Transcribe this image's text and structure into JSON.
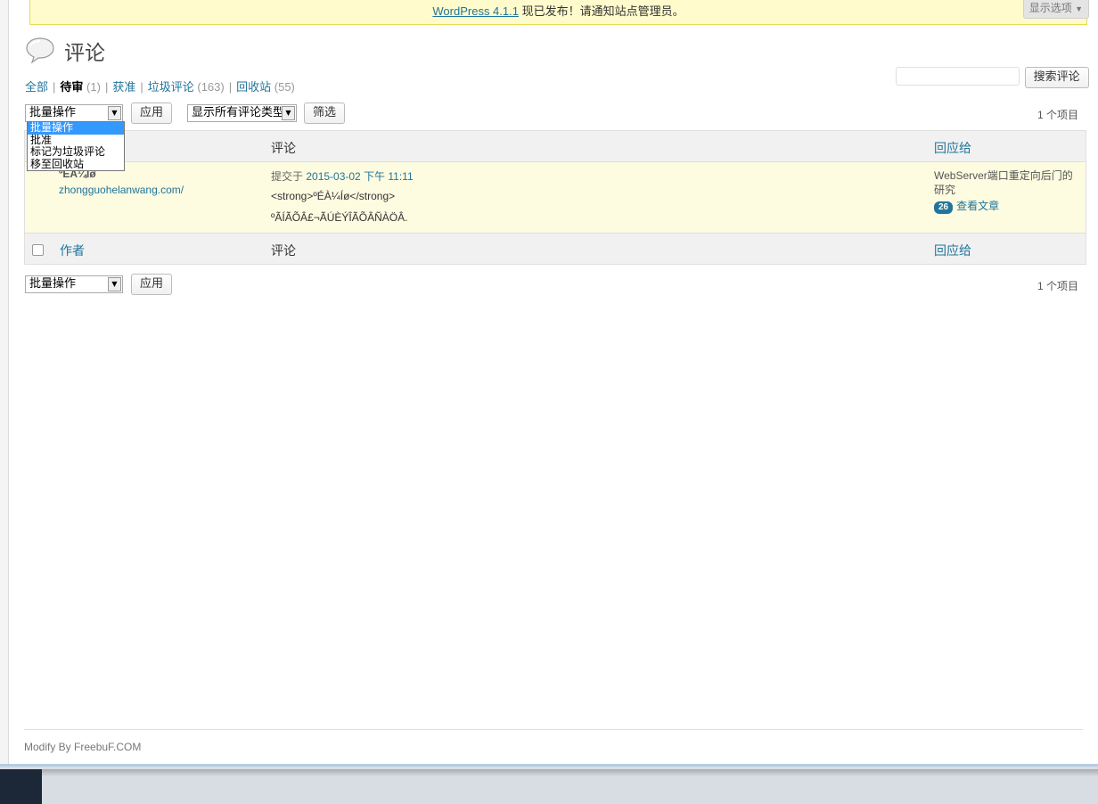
{
  "notice": {
    "link": "WordPress 4.1.1",
    "text": " 现已发布！请通知站点管理员。"
  },
  "screen_options": "显示选项",
  "page": {
    "title": "评论"
  },
  "filters": [
    {
      "label": "全部",
      "count": ""
    },
    {
      "label": "待审",
      "count": "(1)"
    },
    {
      "label": "获准",
      "count": ""
    },
    {
      "label": "垃圾评论",
      "count": "(163)"
    },
    {
      "label": "回收站",
      "count": "(55)"
    }
  ],
  "search": {
    "button": "搜索评论",
    "value": ""
  },
  "bulk": {
    "selected": "批量操作",
    "options": [
      "批量操作",
      "批准",
      "标记为垃圾评论",
      "移至回收站"
    ],
    "apply": "应用"
  },
  "type_filter": {
    "selected": "显示所有评论类型",
    "button": "筛选"
  },
  "displaying": "1 个项目",
  "columns": {
    "author": "作者",
    "comment": "评论",
    "response": "回应给"
  },
  "comment": {
    "author_name": "ºÉÀ¼Íø",
    "author_url": "zhongguohelanwang.com/",
    "submitted_prefix": "提交于 ",
    "submitted_date": "2015-03-02 下午 11:11",
    "line1": "<strong>ºÉÀ¼Íø</strong>",
    "line2": "ºÃÍÃÕÂ£¬ÃÚÈÝÎÃÕÂÑÀÖÂ.",
    "response_title": "WebServer端口重定向后门的研究",
    "comment_count": "26",
    "view_post": "查看文章"
  },
  "footer": "Modify By FreebuF.COM",
  "colors": {
    "link": "#21759b",
    "notice_bg": "#fffbcc",
    "row_bg": "#fdfbe0",
    "dropdown_sel": "#3399ff"
  }
}
